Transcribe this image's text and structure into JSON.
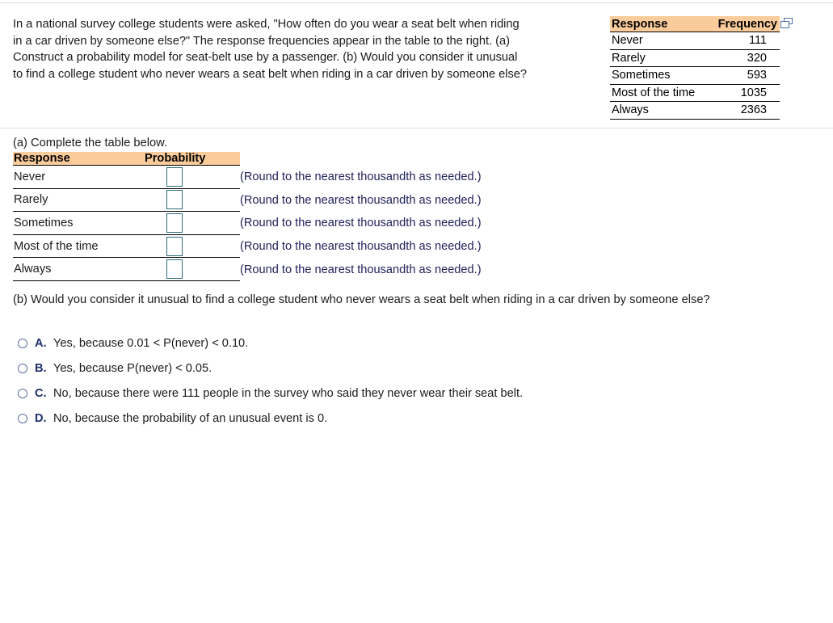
{
  "problem": {
    "statement": "In a national survey college students were asked, \"How often do you wear a seat belt when riding in a car driven by someone else?\" The response frequencies appear in the table to the right. (a) Construct a probability model for seat-belt use by a passenger. (b) Would you consider it unusual to find a college student who never wears a seat belt when riding in a car driven by someone else?"
  },
  "frequency_table": {
    "headers": [
      "Response",
      "Frequency"
    ],
    "rows": [
      {
        "response": "Never",
        "frequency": "111"
      },
      {
        "response": "Rarely",
        "frequency": "320"
      },
      {
        "response": "Sometimes",
        "frequency": "593"
      },
      {
        "response": "Most of the time",
        "frequency": "1035"
      },
      {
        "response": "Always",
        "frequency": "2363"
      }
    ],
    "copy_icon": "copy-icon",
    "header_bg": "#fbcc9b"
  },
  "part_a": {
    "label": "(a) Complete the table below.",
    "headers": [
      "Response",
      "Probability"
    ],
    "rows": [
      {
        "response": "Never",
        "probability": "",
        "note": "(Round to the nearest thousandth as needed.)"
      },
      {
        "response": "Rarely",
        "probability": "",
        "note": "(Round to the nearest thousandth as needed.)"
      },
      {
        "response": "Sometimes",
        "probability": "",
        "note": "(Round to the nearest thousandth as needed.)"
      },
      {
        "response": "Most of the time",
        "probability": "",
        "note": "(Round to the nearest thousandth as needed.)"
      },
      {
        "response": "Always",
        "probability": "",
        "note": "(Round to the nearest thousandth as needed.)"
      }
    ],
    "header_bg": "#fbcc9b",
    "input_border_color": "#2d6e78"
  },
  "part_b": {
    "question": "(b) Would you consider it unusual to find a college student who never wears a seat belt when riding in a car driven by someone else?",
    "choices": [
      {
        "letter": "A.",
        "text": "Yes, because 0.01 < P(never) < 0.10."
      },
      {
        "letter": "B.",
        "text": "Yes, because P(never) < 0.05."
      },
      {
        "letter": "C.",
        "text": "No, because there were 111 people in the survey who said they never wear their seat belt."
      },
      {
        "letter": "D.",
        "text": "No, because the probability of an unusual event is 0."
      }
    ],
    "selected": null,
    "letter_color": "#20306e",
    "radio_color": "#5a6f9e"
  }
}
